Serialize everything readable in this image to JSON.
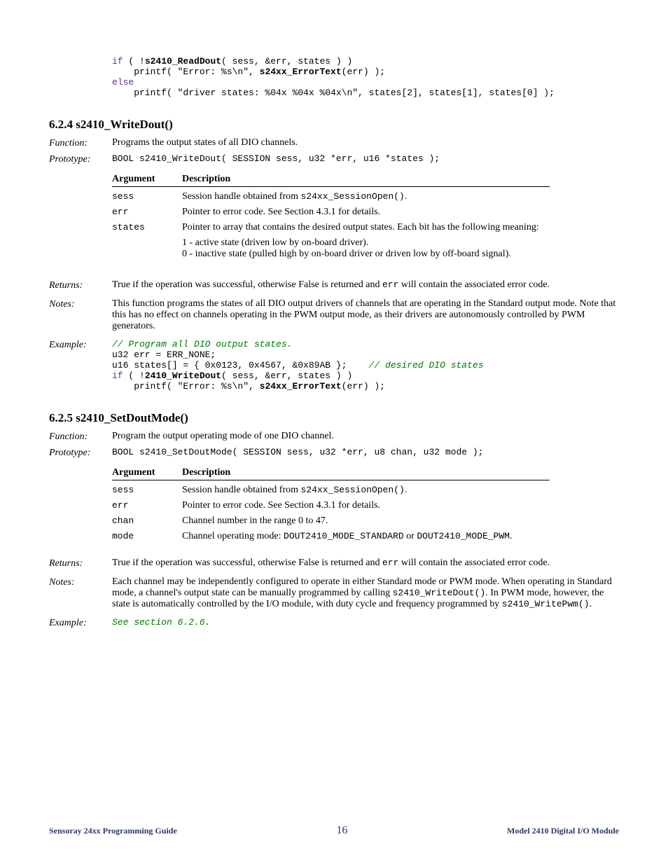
{
  "top_code": {
    "l1a": "if",
    "l1b": " ( !",
    "l1c": "s2410_ReadDout",
    "l1d": "( sess, &err, states ) )",
    "l2a": "    printf( \"Error: %s\\n\", ",
    "l2b": "s24xx_ErrorText",
    "l2c": "(err) );",
    "l3a": "else",
    "l4": "    printf( \"driver states: %04x %04x %04x\\n\", states[2], states[1], states[0] );"
  },
  "s1": {
    "heading": "6.2.4  s2410_WriteDout()",
    "function_label": "Function:",
    "function_text": "Programs the output states of all DIO channels.",
    "prototype_label": "Prototype:",
    "prototype_text": "BOOL s2410_WriteDout( SESSION sess, u32 *err, u16 *states );",
    "arg_h1": "Argument",
    "arg_h2": "Description",
    "r1_name": "sess",
    "r1_desc_a": "Session handle obtained from ",
    "r1_desc_b": "s24xx_SessionOpen()",
    "r1_desc_c": ".",
    "r2_name": "err",
    "r2_desc": "Pointer to error code. See Section 4.3.1 for details.",
    "r3_name": "states",
    "r3_desc": "Pointer to array that contains the desired output states. Each bit has the following meaning:",
    "r3_sub1": "1 - active state (driven low by on-board driver).",
    "r3_sub2": "0 - inactive state (pulled high by on-board driver or driven low by off-board signal).",
    "returns_label": "Returns:",
    "returns_a": "True if the operation was successful, otherwise False is returned and ",
    "returns_b": "err",
    "returns_c": " will contain the associated error code.",
    "notes_label": "Notes:",
    "notes_text": "This function programs the states of all DIO output drivers of channels that are operating in the Standard output mode. Note that this has no effect on channels operating in the PWM output mode, as their drivers are autonomously controlled by PWM generators.",
    "example_label": "Example:",
    "ex_l1": "// Program all DIO output states.",
    "ex_l2": "u32 err = ERR_NONE;",
    "ex_l3a": "u16 states[] = { 0x0123, 0x4567, &0x89AB };    ",
    "ex_l3b": "// desired DIO states",
    "ex_l4a": "if",
    "ex_l4b": " ( !",
    "ex_l4c": "2410_WriteDout",
    "ex_l4d": "( sess, &err, states ) )",
    "ex_l5a": "    printf( \"Error: %s\\n\", ",
    "ex_l5b": "s24xx_ErrorText",
    "ex_l5c": "(err) );"
  },
  "s2": {
    "heading": "6.2.5  s2410_SetDoutMode()",
    "function_label": "Function:",
    "function_text": "Program the output operating mode of one DIO channel.",
    "prototype_label": "Prototype:",
    "prototype_text": "BOOL s2410_SetDoutMode( SESSION sess, u32 *err, u8 chan, u32 mode );",
    "arg_h1": "Argument",
    "arg_h2": "Description",
    "r1_name": "sess",
    "r1_desc_a": "Session handle obtained from ",
    "r1_desc_b": "s24xx_SessionOpen()",
    "r1_desc_c": ".",
    "r2_name": "err",
    "r2_desc": "Pointer to error code. See Section 4.3.1 for details.",
    "r3_name": "chan",
    "r3_desc": "Channel number in the range 0 to 47.",
    "r4_name": "mode",
    "r4_desc_a": "Channel operating mode: ",
    "r4_desc_b": "DOUT2410_MODE_STANDARD",
    "r4_desc_c": " or ",
    "r4_desc_d": "DOUT2410_MODE_PWM",
    "r4_desc_e": ".",
    "returns_label": "Returns:",
    "returns_a": "True if the operation was successful, otherwise False is returned and ",
    "returns_b": "err",
    "returns_c": " will contain the associated error code.",
    "notes_label": "Notes:",
    "notes_a": "Each channel may be independently configured to operate in either Standard mode or PWM mode. When operating in Standard mode, a channel's output state can be manually programmed by calling ",
    "notes_b": "s2410_WriteDout()",
    "notes_c": ". In PWM mode, however, the state is automatically controlled by the I/O module, with duty cycle and frequency programmed by ",
    "notes_d": "s2410_WritePwm()",
    "notes_e": ".",
    "example_label": "Example:",
    "example_text": "See section 6.2.6."
  },
  "footer": {
    "left": "Sensoray 24xx Programming Guide",
    "center": "16",
    "right": "Model 2410 Digital I/O Module"
  }
}
